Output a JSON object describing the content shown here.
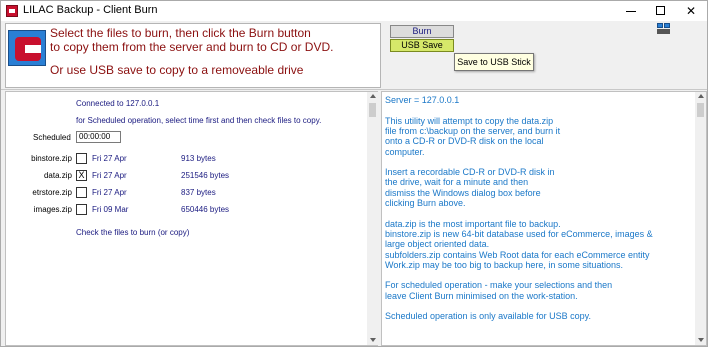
{
  "window": {
    "title": "LILAC Backup - Client Burn"
  },
  "header": {
    "line1": "Select the files to burn, then click the Burn button",
    "line2": "to copy them from the server and burn to CD or DVD.",
    "line3": "Or use USB save to copy to a removeable drive"
  },
  "buttons": {
    "burn": "Burn",
    "usb_save": "USB Save",
    "tooltip": "Save to USB Stick"
  },
  "left": {
    "connected": "Connected to 127.0.0.1",
    "scheduled_note": "for Scheduled operation, select time first and then check files to copy.",
    "scheduled_label": "Scheduled",
    "scheduled_value": "00:00:00",
    "files": [
      {
        "name": "binstore.zip",
        "checked": "",
        "date": "Fri 27 Apr",
        "size": "913 bytes"
      },
      {
        "name": "data.zip",
        "checked": "X",
        "date": "Fri 27 Apr",
        "size": "251546 bytes"
      },
      {
        "name": "etrstore.zip",
        "checked": "",
        "date": "Fri 27 Apr",
        "size": "837 bytes"
      },
      {
        "name": "images.zip",
        "checked": "",
        "date": "Fri 09 Mar",
        "size": "650446 bytes"
      }
    ],
    "hint": "Check the files to burn (or copy)"
  },
  "right": {
    "lines": [
      "Server = 127.0.0.1",
      "",
      "This utility will attempt to copy the data.zip",
      "file from c:\\backup on the server, and burn it",
      "onto a CD-R or DVD-R disk on the local",
      "computer.",
      "",
      "Insert a recordable CD-R or DVD-R disk in",
      "the drive, wait for a minute and then",
      "dismiss the Windows dialog box before",
      "clicking Burn above.",
      "",
      "data.zip is the most important file to backup.",
      "binstore.zip is new 64-bit database used for eCommerce, images &",
      "large object oriented data.",
      "subfolders.zip contains Web Root data for each eCommerce entity",
      "Work.zip may be too big to backup here, in some situations.",
      "",
      "For scheduled operation - make your selections and then",
      "leave Client Burn minimised on the work-station.",
      "",
      "Scheduled operation is only available for USB copy."
    ]
  },
  "colors": {
    "header_text": "#8b1010",
    "left_text": "#1a1a80",
    "right_text": "#1b78c8",
    "usb_button": "#d6e86a"
  }
}
